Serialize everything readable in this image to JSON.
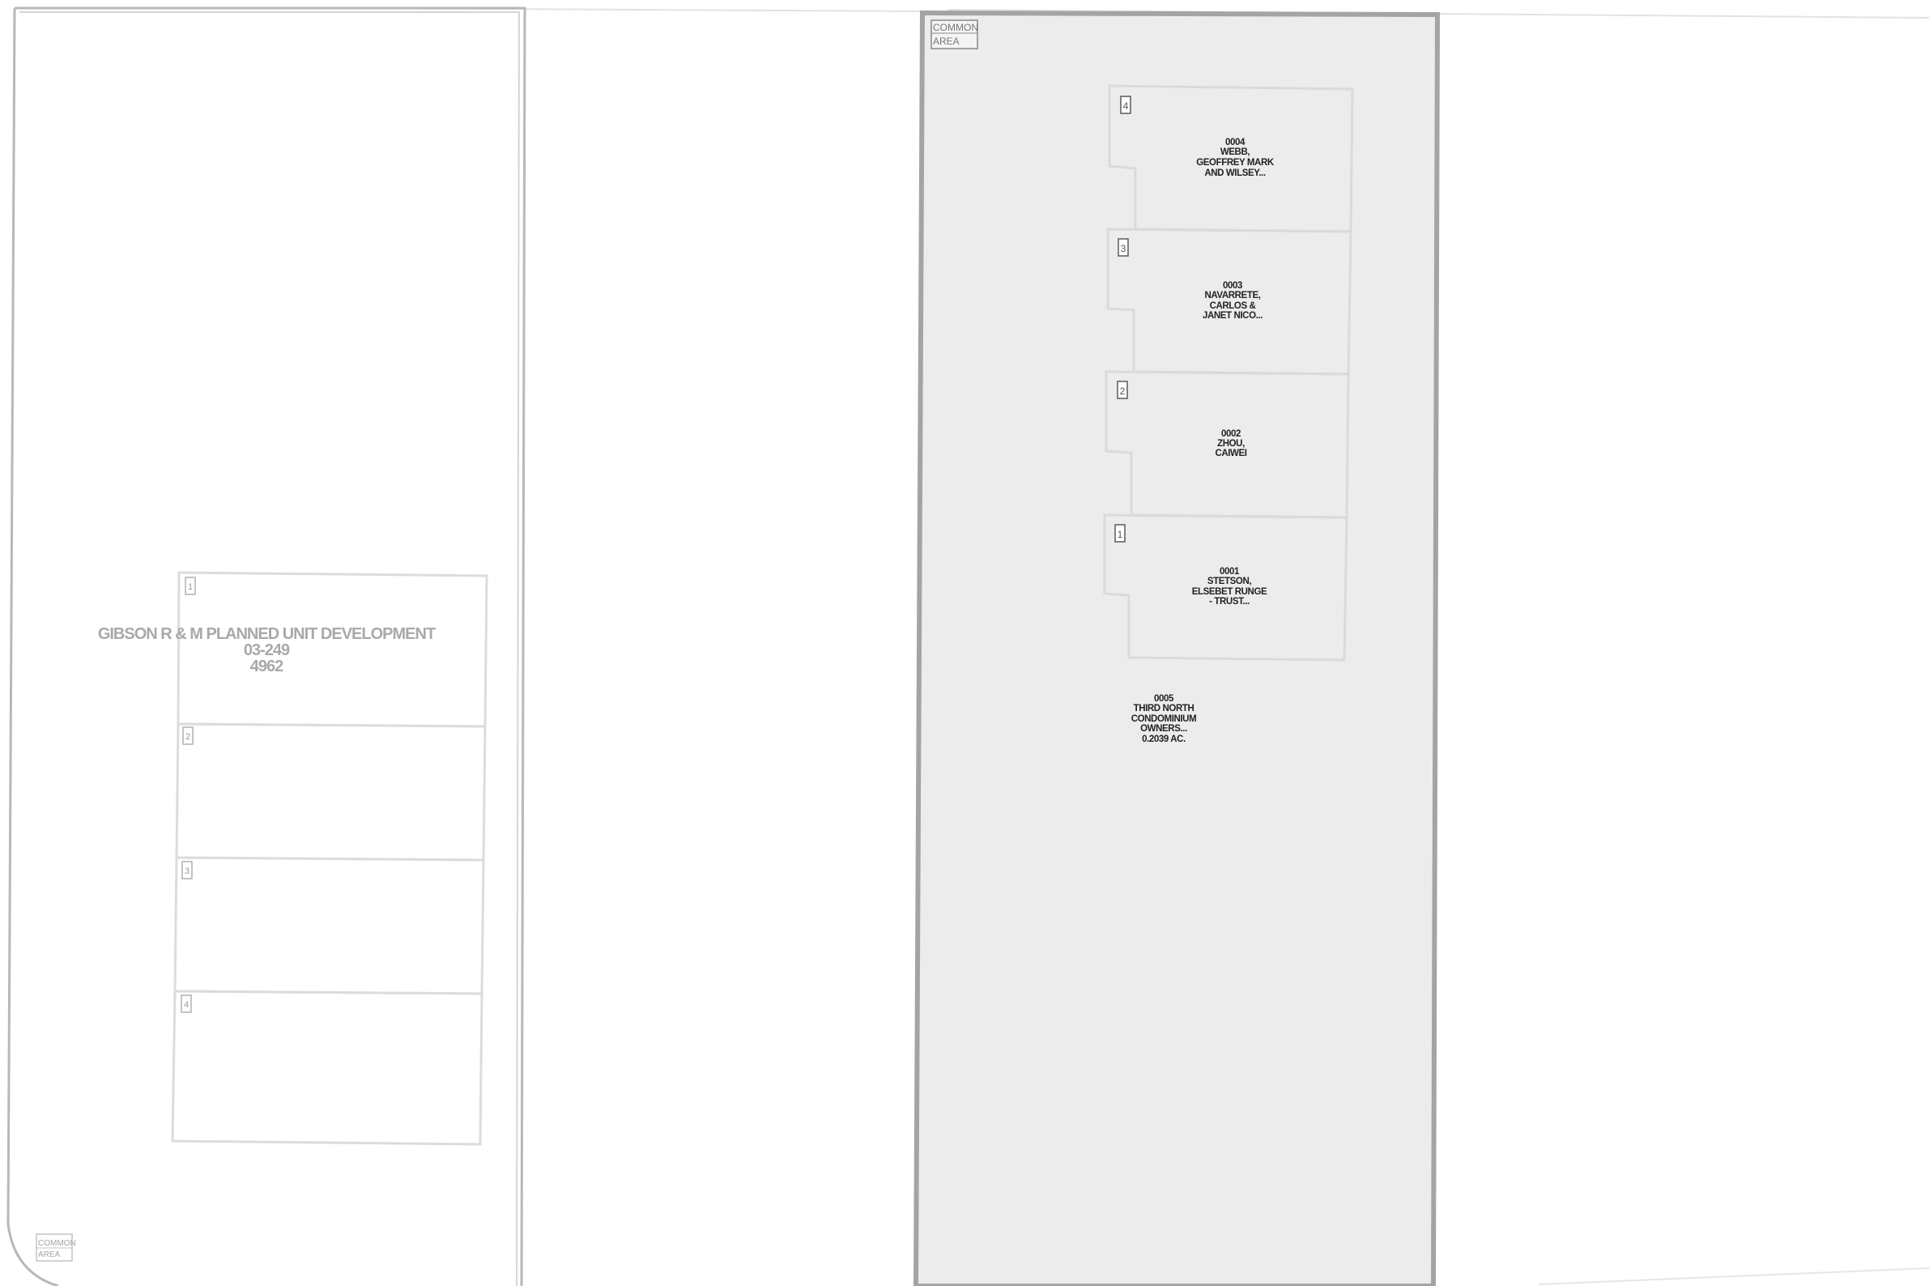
{
  "subdivision": {
    "name": "GIBSON R & M PLANNED UNIT DEVELOPMENT",
    "book_page": "03-249",
    "parcel_id": "4962",
    "common_area_label": [
      "COMMON",
      "AREA"
    ],
    "units": [
      "1",
      "2",
      "3",
      "4"
    ]
  },
  "condominium": {
    "common_area_label": [
      "COMMON",
      "AREA"
    ],
    "fill_color": "#ececec",
    "units": [
      {
        "number": "4",
        "owner_lines": [
          "0004",
          "WEBB,",
          "GEOFFREY MARK",
          "AND WILSEY..."
        ]
      },
      {
        "number": "3",
        "owner_lines": [
          "0003",
          "NAVARRETE,",
          "CARLOS &",
          "JANET NICO..."
        ]
      },
      {
        "number": "2",
        "owner_lines": [
          "0002",
          "ZHOU,",
          "CAIWEI"
        ]
      },
      {
        "number": "1",
        "owner_lines": [
          "0001",
          "STETSON,",
          "ELSEBET RUNGE",
          "- TRUST..."
        ]
      }
    ],
    "common_parcel_lines": [
      "0005",
      "THIRD NORTH",
      "CONDOMINIUM",
      "OWNERS...",
      "0.2039 AC."
    ]
  }
}
